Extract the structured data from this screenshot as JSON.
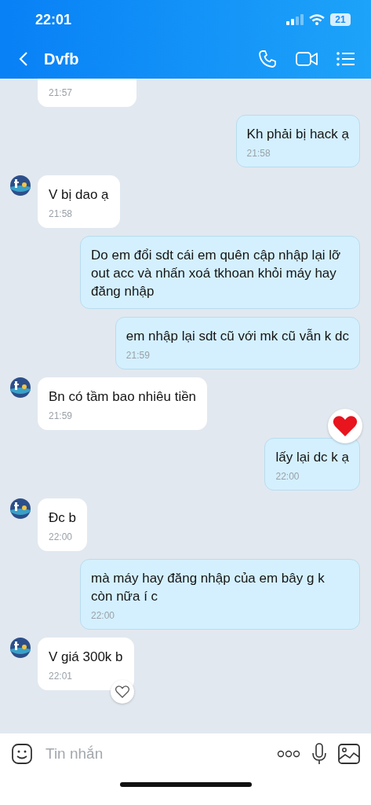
{
  "status_bar": {
    "time": "22:01",
    "battery": "21"
  },
  "header": {
    "title": "Dvfb"
  },
  "messages": [
    {
      "kind": "incoming",
      "avatar": false,
      "time": "21:57"
    },
    {
      "kind": "outgoing",
      "text": "Kh phải bị hack ạ",
      "time": "21:58"
    },
    {
      "kind": "incoming",
      "avatar": true,
      "text": "V bị dao ạ",
      "time": "21:58"
    },
    {
      "kind": "outgoing",
      "text": "Do em đổi sdt cái em quên cập nhập lại lỡ out acc và nhấn xoá tkhoan khỏi máy hay đăng nhập"
    },
    {
      "kind": "outgoing",
      "text": "em nhập lại sdt cũ với mk cũ vẫn k dc",
      "time": "21:59"
    },
    {
      "kind": "incoming",
      "avatar": true,
      "text": "Bn có tầm bao nhiêu tiền",
      "time": "21:59"
    },
    {
      "kind": "outgoing",
      "text": "lấy lại dc k ạ",
      "time": "22:00",
      "liked": true
    },
    {
      "kind": "incoming",
      "avatar": true,
      "text": "Đc b",
      "time": "22:00"
    },
    {
      "kind": "outgoing",
      "text": "mà máy hay đăng nhập của em bây g k còn nữa í c",
      "time": "22:00"
    },
    {
      "kind": "incoming",
      "avatar": true,
      "text": "V giá 300k b",
      "time": "22:01",
      "liked": false
    }
  ],
  "composer": {
    "placeholder": "Tin nhắn"
  }
}
